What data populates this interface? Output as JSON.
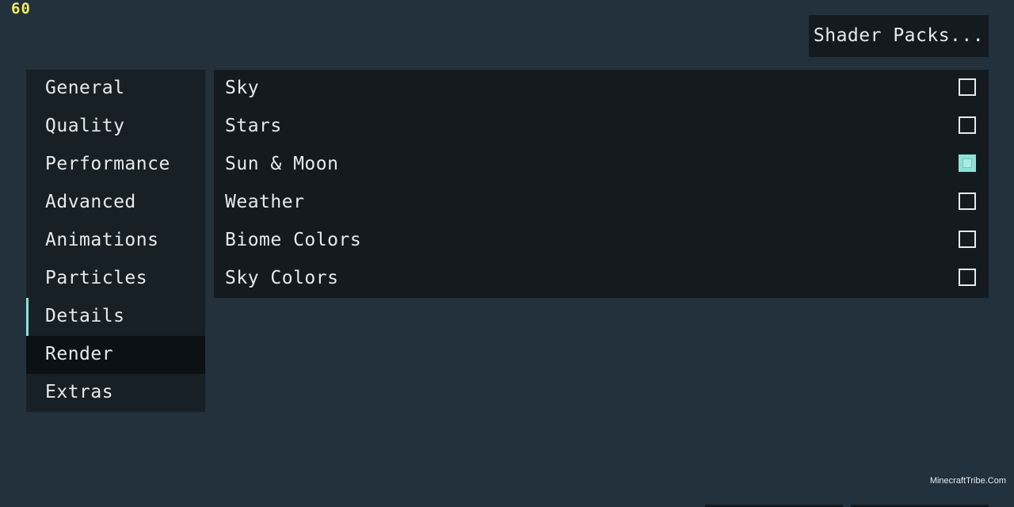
{
  "hud": {
    "fps": "60"
  },
  "header": {
    "shader_packs_label": "Shader Packs..."
  },
  "sidebar": {
    "items": [
      {
        "label": "General"
      },
      {
        "label": "Quality"
      },
      {
        "label": "Performance"
      },
      {
        "label": "Advanced"
      },
      {
        "label": "Animations"
      },
      {
        "label": "Particles"
      },
      {
        "label": "Details"
      },
      {
        "label": "Render"
      },
      {
        "label": "Extras"
      }
    ],
    "selected": "Render"
  },
  "options": {
    "items": [
      {
        "label": "Sky",
        "checked": false
      },
      {
        "label": "Stars",
        "checked": false
      },
      {
        "label": "Sun & Moon",
        "checked": true
      },
      {
        "label": "Weather",
        "checked": false
      },
      {
        "label": "Biome Colors",
        "checked": false
      },
      {
        "label": "Sky Colors",
        "checked": false
      }
    ]
  },
  "footer": {
    "watermark": "MinecraftTribe.Com"
  },
  "colors": {
    "background": "#23313c",
    "panel": "#131b21",
    "sidebar": "#172027",
    "accent": "#8fe0d4",
    "fps": "#f2ee5a"
  }
}
